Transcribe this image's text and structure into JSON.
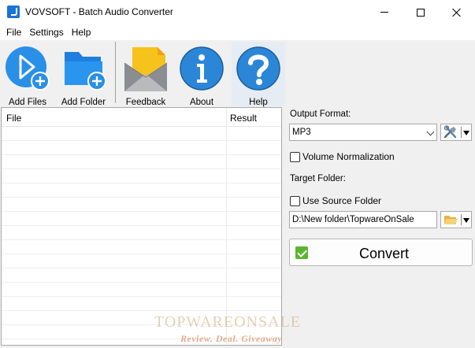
{
  "window": {
    "title": "VOVSOFT - Batch Audio Converter",
    "icon": "music-note-icon"
  },
  "menu": [
    "File",
    "Settings",
    "Help"
  ],
  "toolbar": {
    "add_files": "Add Files",
    "add_folder": "Add Folder",
    "feedback": "Feedback",
    "about": "About",
    "help": "Help"
  },
  "file_list": {
    "columns": [
      "File",
      "Result"
    ],
    "rows": []
  },
  "output": {
    "format_label": "Output Format:",
    "format_value": "MP3",
    "volume_normalization": "Volume Normalization",
    "volume_normalization_checked": false,
    "target_folder_label": "Target Folder:",
    "use_source_folder": "Use Source Folder",
    "use_source_folder_checked": false,
    "target_folder_value": "D:\\New folder\\TopwareOnSale",
    "convert": "Convert"
  },
  "watermark": {
    "line1": "TOPWAREONSALE",
    "line2": "Review. Deal. Giveaway"
  },
  "colors": {
    "accent_blue": "#2a8fe6",
    "convert_green": "#5cb531",
    "feedback_yellow": "#f6c21c"
  }
}
